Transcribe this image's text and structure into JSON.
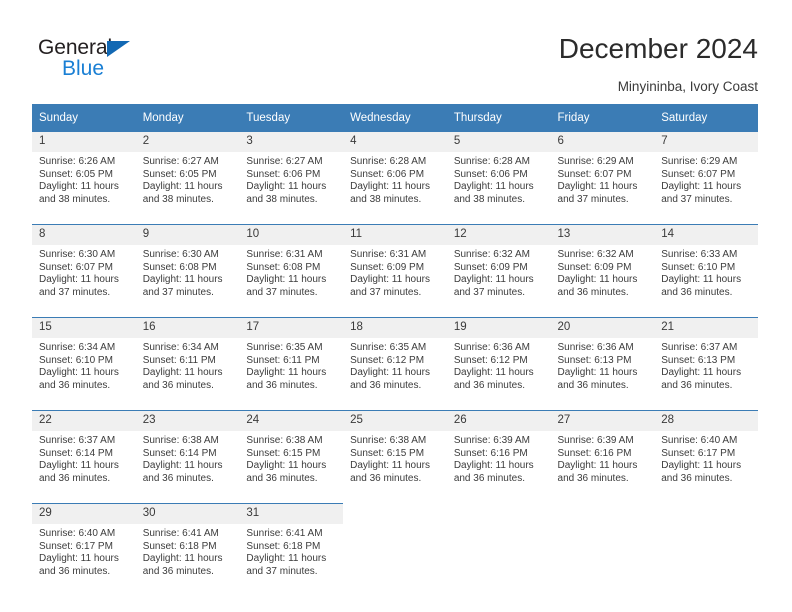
{
  "brand": {
    "word1": "General",
    "word2": "Blue",
    "accent_color": "#1268b3",
    "blue_text_color": "#1a7fd4"
  },
  "header": {
    "title": "December 2024",
    "subtitle": "Minyininba, Ivory Coast"
  },
  "calendar": {
    "header_bg": "#3b7cb5",
    "date_band_bg": "#f0f0f0",
    "weekdays": [
      "Sunday",
      "Monday",
      "Tuesday",
      "Wednesday",
      "Thursday",
      "Friday",
      "Saturday"
    ],
    "weeks": [
      {
        "dates": [
          "1",
          "2",
          "3",
          "4",
          "5",
          "6",
          "7"
        ],
        "cells": [
          {
            "sunrise": "Sunrise: 6:26 AM",
            "sunset": "Sunset: 6:05 PM",
            "daylight_1": "Daylight: 11 hours",
            "daylight_2": "and 38 minutes."
          },
          {
            "sunrise": "Sunrise: 6:27 AM",
            "sunset": "Sunset: 6:05 PM",
            "daylight_1": "Daylight: 11 hours",
            "daylight_2": "and 38 minutes."
          },
          {
            "sunrise": "Sunrise: 6:27 AM",
            "sunset": "Sunset: 6:06 PM",
            "daylight_1": "Daylight: 11 hours",
            "daylight_2": "and 38 minutes."
          },
          {
            "sunrise": "Sunrise: 6:28 AM",
            "sunset": "Sunset: 6:06 PM",
            "daylight_1": "Daylight: 11 hours",
            "daylight_2": "and 38 minutes."
          },
          {
            "sunrise": "Sunrise: 6:28 AM",
            "sunset": "Sunset: 6:06 PM",
            "daylight_1": "Daylight: 11 hours",
            "daylight_2": "and 38 minutes."
          },
          {
            "sunrise": "Sunrise: 6:29 AM",
            "sunset": "Sunset: 6:07 PM",
            "daylight_1": "Daylight: 11 hours",
            "daylight_2": "and 37 minutes."
          },
          {
            "sunrise": "Sunrise: 6:29 AM",
            "sunset": "Sunset: 6:07 PM",
            "daylight_1": "Daylight: 11 hours",
            "daylight_2": "and 37 minutes."
          }
        ]
      },
      {
        "dates": [
          "8",
          "9",
          "10",
          "11",
          "12",
          "13",
          "14"
        ],
        "cells": [
          {
            "sunrise": "Sunrise: 6:30 AM",
            "sunset": "Sunset: 6:07 PM",
            "daylight_1": "Daylight: 11 hours",
            "daylight_2": "and 37 minutes."
          },
          {
            "sunrise": "Sunrise: 6:30 AM",
            "sunset": "Sunset: 6:08 PM",
            "daylight_1": "Daylight: 11 hours",
            "daylight_2": "and 37 minutes."
          },
          {
            "sunrise": "Sunrise: 6:31 AM",
            "sunset": "Sunset: 6:08 PM",
            "daylight_1": "Daylight: 11 hours",
            "daylight_2": "and 37 minutes."
          },
          {
            "sunrise": "Sunrise: 6:31 AM",
            "sunset": "Sunset: 6:09 PM",
            "daylight_1": "Daylight: 11 hours",
            "daylight_2": "and 37 minutes."
          },
          {
            "sunrise": "Sunrise: 6:32 AM",
            "sunset": "Sunset: 6:09 PM",
            "daylight_1": "Daylight: 11 hours",
            "daylight_2": "and 37 minutes."
          },
          {
            "sunrise": "Sunrise: 6:32 AM",
            "sunset": "Sunset: 6:09 PM",
            "daylight_1": "Daylight: 11 hours",
            "daylight_2": "and 36 minutes."
          },
          {
            "sunrise": "Sunrise: 6:33 AM",
            "sunset": "Sunset: 6:10 PM",
            "daylight_1": "Daylight: 11 hours",
            "daylight_2": "and 36 minutes."
          }
        ]
      },
      {
        "dates": [
          "15",
          "16",
          "17",
          "18",
          "19",
          "20",
          "21"
        ],
        "cells": [
          {
            "sunrise": "Sunrise: 6:34 AM",
            "sunset": "Sunset: 6:10 PM",
            "daylight_1": "Daylight: 11 hours",
            "daylight_2": "and 36 minutes."
          },
          {
            "sunrise": "Sunrise: 6:34 AM",
            "sunset": "Sunset: 6:11 PM",
            "daylight_1": "Daylight: 11 hours",
            "daylight_2": "and 36 minutes."
          },
          {
            "sunrise": "Sunrise: 6:35 AM",
            "sunset": "Sunset: 6:11 PM",
            "daylight_1": "Daylight: 11 hours",
            "daylight_2": "and 36 minutes."
          },
          {
            "sunrise": "Sunrise: 6:35 AM",
            "sunset": "Sunset: 6:12 PM",
            "daylight_1": "Daylight: 11 hours",
            "daylight_2": "and 36 minutes."
          },
          {
            "sunrise": "Sunrise: 6:36 AM",
            "sunset": "Sunset: 6:12 PM",
            "daylight_1": "Daylight: 11 hours",
            "daylight_2": "and 36 minutes."
          },
          {
            "sunrise": "Sunrise: 6:36 AM",
            "sunset": "Sunset: 6:13 PM",
            "daylight_1": "Daylight: 11 hours",
            "daylight_2": "and 36 minutes."
          },
          {
            "sunrise": "Sunrise: 6:37 AM",
            "sunset": "Sunset: 6:13 PM",
            "daylight_1": "Daylight: 11 hours",
            "daylight_2": "and 36 minutes."
          }
        ]
      },
      {
        "dates": [
          "22",
          "23",
          "24",
          "25",
          "26",
          "27",
          "28"
        ],
        "cells": [
          {
            "sunrise": "Sunrise: 6:37 AM",
            "sunset": "Sunset: 6:14 PM",
            "daylight_1": "Daylight: 11 hours",
            "daylight_2": "and 36 minutes."
          },
          {
            "sunrise": "Sunrise: 6:38 AM",
            "sunset": "Sunset: 6:14 PM",
            "daylight_1": "Daylight: 11 hours",
            "daylight_2": "and 36 minutes."
          },
          {
            "sunrise": "Sunrise: 6:38 AM",
            "sunset": "Sunset: 6:15 PM",
            "daylight_1": "Daylight: 11 hours",
            "daylight_2": "and 36 minutes."
          },
          {
            "sunrise": "Sunrise: 6:38 AM",
            "sunset": "Sunset: 6:15 PM",
            "daylight_1": "Daylight: 11 hours",
            "daylight_2": "and 36 minutes."
          },
          {
            "sunrise": "Sunrise: 6:39 AM",
            "sunset": "Sunset: 6:16 PM",
            "daylight_1": "Daylight: 11 hours",
            "daylight_2": "and 36 minutes."
          },
          {
            "sunrise": "Sunrise: 6:39 AM",
            "sunset": "Sunset: 6:16 PM",
            "daylight_1": "Daylight: 11 hours",
            "daylight_2": "and 36 minutes."
          },
          {
            "sunrise": "Sunrise: 6:40 AM",
            "sunset": "Sunset: 6:17 PM",
            "daylight_1": "Daylight: 11 hours",
            "daylight_2": "and 36 minutes."
          }
        ]
      },
      {
        "dates": [
          "29",
          "30",
          "31",
          "",
          "",
          "",
          ""
        ],
        "cells": [
          {
            "sunrise": "Sunrise: 6:40 AM",
            "sunset": "Sunset: 6:17 PM",
            "daylight_1": "Daylight: 11 hours",
            "daylight_2": "and 36 minutes."
          },
          {
            "sunrise": "Sunrise: 6:41 AM",
            "sunset": "Sunset: 6:18 PM",
            "daylight_1": "Daylight: 11 hours",
            "daylight_2": "and 36 minutes."
          },
          {
            "sunrise": "Sunrise: 6:41 AM",
            "sunset": "Sunset: 6:18 PM",
            "daylight_1": "Daylight: 11 hours",
            "daylight_2": "and 37 minutes."
          },
          {
            "sunrise": "",
            "sunset": "",
            "daylight_1": "",
            "daylight_2": ""
          },
          {
            "sunrise": "",
            "sunset": "",
            "daylight_1": "",
            "daylight_2": ""
          },
          {
            "sunrise": "",
            "sunset": "",
            "daylight_1": "",
            "daylight_2": ""
          },
          {
            "sunrise": "",
            "sunset": "",
            "daylight_1": "",
            "daylight_2": ""
          }
        ]
      }
    ]
  }
}
